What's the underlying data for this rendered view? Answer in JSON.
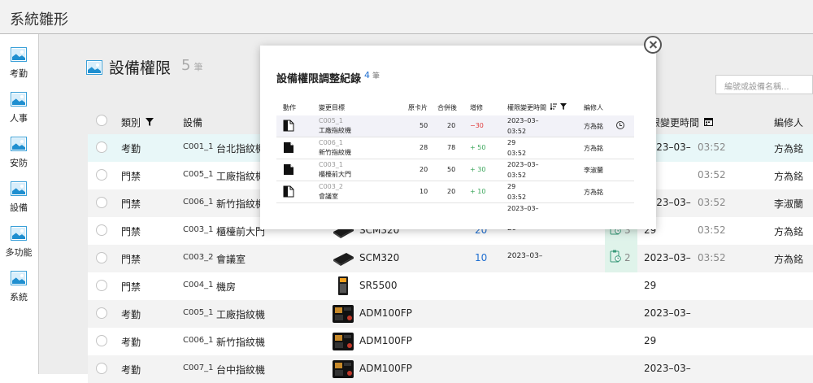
{
  "app": {
    "title": "系統雛形"
  },
  "sidebar": {
    "items": [
      {
        "label": "考勤"
      },
      {
        "label": "人事"
      },
      {
        "label": "安防"
      },
      {
        "label": "設備"
      },
      {
        "label": "多功能"
      },
      {
        "label": "系統"
      }
    ]
  },
  "page": {
    "title": "設備權限",
    "count": "5",
    "count_unit": "筆",
    "search_placeholder": "編號或設備名稱..."
  },
  "table": {
    "headers": {
      "type": "類別",
      "device": "設備",
      "change_time": "限變更時間",
      "editor": "編修人"
    },
    "rows": [
      {
        "type": "考勤",
        "code": "C001_1",
        "name": "台北指紋機",
        "model": "",
        "value": "",
        "audit_time": "",
        "change_count": "",
        "date": "2023–03–",
        "time": "03:52",
        "editor": "方為銘",
        "highlight": true
      },
      {
        "type": "門禁",
        "code": "C005_1",
        "name": "工廠指紋機",
        "model": "",
        "value": "",
        "audit_time": "",
        "change_count": "",
        "date": "",
        "time": "03:52",
        "editor": "方為銘"
      },
      {
        "type": "門禁",
        "code": "C006_1",
        "name": "新竹指紋機",
        "model": "",
        "value": "",
        "audit_time": "",
        "change_count": "",
        "date": "2023–03–",
        "time": "03:52",
        "editor": "李淑蘭"
      },
      {
        "type": "門禁",
        "code": "C003_1",
        "name": "櫃檯前大門",
        "model": "SCM320",
        "value": "20",
        "audit_time": "29",
        "change_count": "3",
        "date": "29",
        "time": "03:52",
        "editor": "方為銘"
      },
      {
        "type": "門禁",
        "code": "C003_2",
        "name": "會議室",
        "model": "SCM320",
        "value": "10",
        "audit_time": "2023–03–",
        "change_count": "2",
        "date": "2023–03–",
        "time": "03:52",
        "editor": "方為銘"
      },
      {
        "type": "門禁",
        "code": "C004_1",
        "name": "機房",
        "model": "SR5500",
        "value": "",
        "audit_time": "",
        "change_count": "",
        "date": "29",
        "time": "",
        "editor": ""
      },
      {
        "type": "考勤",
        "code": "C005_1",
        "name": "工廠指紋機",
        "model": "ADM100FP",
        "value": "",
        "audit_time": "",
        "change_count": "",
        "date": "2023–03–",
        "time": "",
        "editor": ""
      },
      {
        "type": "考勤",
        "code": "C006_1",
        "name": "新竹指紋機",
        "model": "ADM100FP",
        "value": "",
        "audit_time": "",
        "change_count": "",
        "date": "29",
        "time": "",
        "editor": ""
      },
      {
        "type": "考勤",
        "code": "C007_1",
        "name": "台中指紋機",
        "model": "ADM100FP",
        "value": "",
        "audit_time": "",
        "change_count": "",
        "date": "2023–03–",
        "time": "",
        "editor": ""
      }
    ]
  },
  "modal": {
    "title": "設備權限調整紀錄",
    "count": "4",
    "count_unit": "筆",
    "headers": {
      "action": "動作",
      "target": "變更目標",
      "before": "原卡片",
      "after": "合併後",
      "delta": "增修",
      "time": "權限變更時間",
      "editor": "編修人"
    },
    "rows": [
      {
        "code": "C005_1",
        "name": "工廠指紋機",
        "before": "50",
        "after": "20",
        "delta": "−30",
        "delta_kind": "red",
        "date": "2023–03–",
        "time": "03:52",
        "editor": "方為銘"
      },
      {
        "code": "C006_1",
        "name": "新竹指紋機",
        "before": "28",
        "after": "78",
        "delta": "+ 50",
        "delta_kind": "green",
        "date": "29",
        "time": "03:52",
        "editor": "方為銘"
      },
      {
        "code": "C003_1",
        "name": "櫃檯前大門",
        "before": "20",
        "after": "50",
        "delta": "+ 30",
        "delta_kind": "green",
        "date": "2023–03–",
        "time": "03:52",
        "editor": "李淑蘭"
      },
      {
        "code": "C003_2",
        "name": "會議室",
        "before": "10",
        "after": "20",
        "delta": "+ 10",
        "delta_kind": "green",
        "date": "29",
        "time": "03:52",
        "editor": "方為銘"
      }
    ],
    "trailing_date": "2023–03–"
  },
  "colors": {
    "accent": "#1f6fd1",
    "highlight": "#e8f7f8",
    "positive": "#3aa65a",
    "negative": "#e03c3c"
  }
}
